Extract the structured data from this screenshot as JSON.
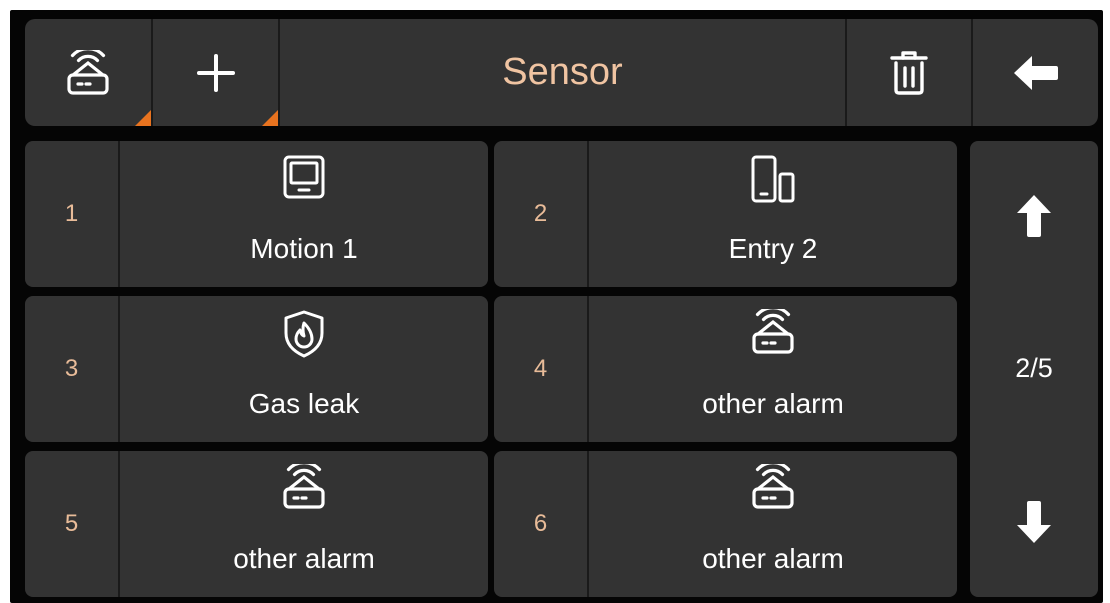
{
  "header": {
    "title": "Sensor",
    "buttons": {
      "alarm": {
        "icon": "router-alarm-icon"
      },
      "add": {
        "icon": "plus-icon"
      },
      "delete": {
        "icon": "trash-icon"
      },
      "back": {
        "icon": "arrow-left-icon"
      }
    }
  },
  "sensors": [
    {
      "number": "1",
      "label": "Motion 1",
      "icon": "motion-sensor-icon"
    },
    {
      "number": "2",
      "label": "Entry 2",
      "icon": "entry-sensor-icon"
    },
    {
      "number": "3",
      "label": "Gas leak",
      "icon": "gas-shield-icon"
    },
    {
      "number": "4",
      "label": "other alarm",
      "icon": "router-alarm-icon"
    },
    {
      "number": "5",
      "label": "other alarm",
      "icon": "router-alarm-icon"
    },
    {
      "number": "6",
      "label": "other alarm",
      "icon": "router-alarm-icon"
    }
  ],
  "pagination": {
    "text": "2/5",
    "up_icon": "arrow-up-icon",
    "down_icon": "arrow-down-icon"
  },
  "colors": {
    "background": "#050505",
    "panel": "#333333",
    "title": "#f0c4a2",
    "number": "#e9bc99",
    "accent": "#e8731f",
    "text": "#ffffff"
  }
}
